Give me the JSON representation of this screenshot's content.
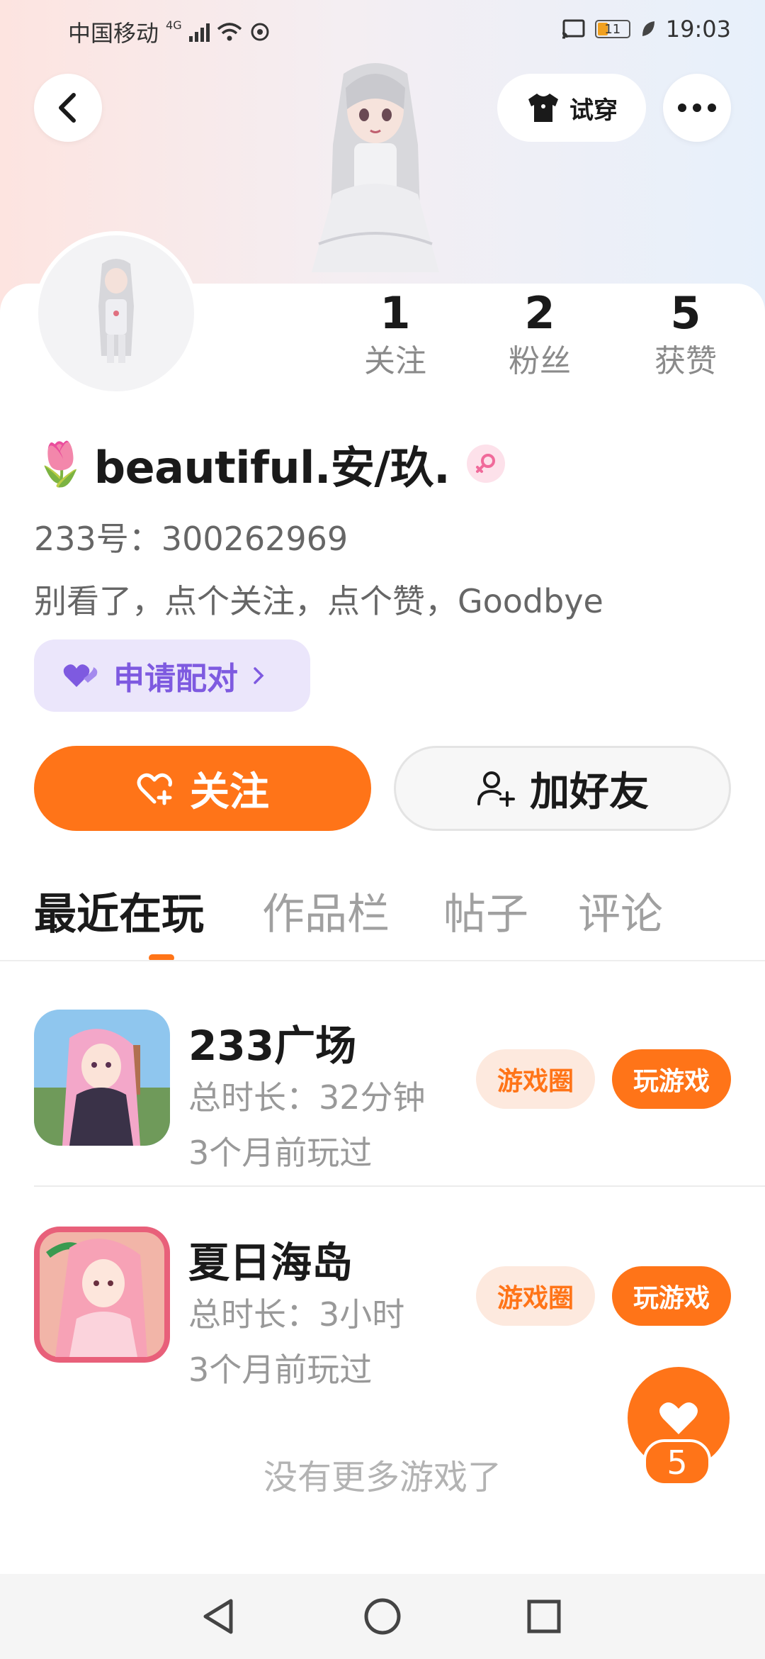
{
  "status_bar": {
    "carrier": "中国移动",
    "network": "4G",
    "battery": "11",
    "time": "19:03"
  },
  "header": {
    "try_on_label": "试穿"
  },
  "profile": {
    "stats": [
      {
        "value": "1",
        "label": "关注"
      },
      {
        "value": "2",
        "label": "粉丝"
      },
      {
        "value": "5",
        "label": "获赞"
      }
    ],
    "name_emoji": "🌷",
    "name": "beautiful.安/玖.",
    "uid": "233号：300262969",
    "bio": "别看了，点个关注，点个赞，Goodbye",
    "pair_label": "申请配对"
  },
  "actions": {
    "follow_label": "关注",
    "add_friend_label": "加好友"
  },
  "tabs": [
    {
      "label": "最近在玩",
      "active": true
    },
    {
      "label": "作品栏",
      "active": false
    },
    {
      "label": "帖子",
      "active": false
    },
    {
      "label": "评论",
      "active": false
    }
  ],
  "games": [
    {
      "title": "233广场",
      "duration": "总时长：32分钟",
      "last_played": "3个月前玩过",
      "circle_label": "游戏圈",
      "play_label": "玩游戏"
    },
    {
      "title": "夏日海岛",
      "duration": "总时长：3小时",
      "last_played": "3个月前玩过",
      "circle_label": "游戏圈",
      "play_label": "玩游戏"
    }
  ],
  "no_more_text": "没有更多游戏了",
  "like_fab": {
    "count": "5"
  },
  "colors": {
    "accent": "#ff7418",
    "pair_purple": "#7e5ae0"
  }
}
